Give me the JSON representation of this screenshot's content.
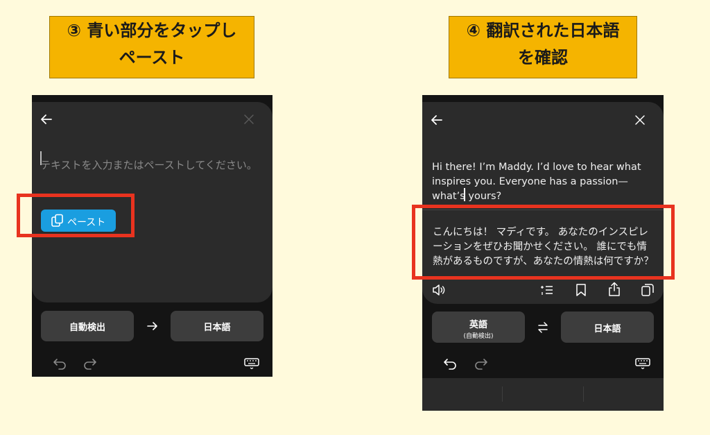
{
  "labels": {
    "left": {
      "line1": "③ 青い部分をタップし",
      "line2": "ペースト"
    },
    "right": {
      "line1": "④ 翻訳された日本語",
      "line2": "を確認"
    }
  },
  "left_screen": {
    "placeholder": "テキストを入力またはペーストしてください。",
    "paste_button": "ペースト",
    "source_lang": "自動検出",
    "target_lang": "日本語",
    "icons": [
      "back-arrow-icon",
      "close-icon",
      "clipboard-icon",
      "right-arrow-icon",
      "undo-icon",
      "redo-icon",
      "keyboard-icon"
    ]
  },
  "right_screen": {
    "source_text": "Hi there! I’m Maddy. I’d love to hear what inspires you. Everyone has a passion—what’s yours?",
    "translated_text": "こんにちは！ マディです。 あなたのインスピレーションをぜひお聞かせください。 誰にでも情熱があるものですが、あなたの情熱は何ですか？",
    "source_lang": "英語",
    "source_lang_sub": "(自動検出)",
    "target_lang": "日本語",
    "icons": [
      "back-arrow-icon",
      "close-icon",
      "speaker-icon",
      "list-icon",
      "bookmark-icon",
      "share-icon",
      "copy-icon",
      "swap-icon",
      "undo-icon",
      "redo-icon",
      "keyboard-icon"
    ]
  },
  "colors": {
    "background": "#fffadc",
    "label": "#f5b400",
    "highlight": "#e8331f",
    "paste_button": "#1a9ee0"
  }
}
